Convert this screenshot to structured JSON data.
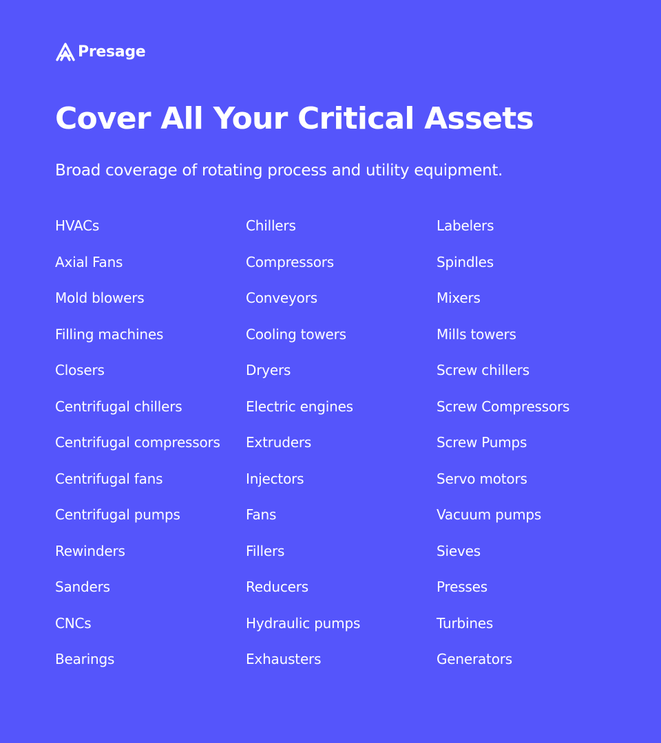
{
  "colors": {
    "background": "#5555fb",
    "text": "#ffffff"
  },
  "brand": {
    "name": "Presage",
    "icon": "presage-logo-icon"
  },
  "title": "Cover All Your Critical Assets",
  "subtitle": "Broad coverage of rotating process and utility equipment.",
  "columns": [
    [
      "HVACs",
      "Axial Fans",
      "Mold blowers",
      "Filling machines",
      "Closers",
      "Centrifugal chillers",
      "Centrifugal compressors",
      "Centrifugal fans",
      "Centrifugal pumps",
      "Rewinders",
      "Sanders",
      "CNCs",
      "Bearings"
    ],
    [
      "Chillers",
      "Compressors",
      "Conveyors",
      "Cooling towers",
      "Dryers",
      "Electric engines",
      "Extruders",
      "Injectors",
      "Fans",
      "Fillers",
      "Reducers",
      "Hydraulic pumps",
      "Exhausters"
    ],
    [
      "Labelers",
      "Spindles",
      "Mixers",
      "Mills towers",
      "Screw chillers",
      "Screw Compressors",
      "Screw Pumps",
      "Servo motors",
      "Vacuum pumps",
      "Sieves",
      "Presses",
      "Turbines",
      "Generators"
    ]
  ]
}
